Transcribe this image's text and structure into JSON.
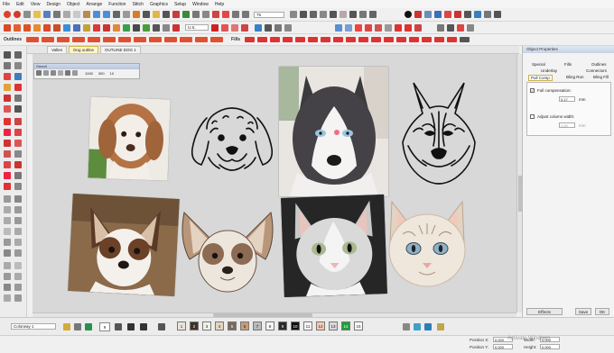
{
  "menu": [
    "File",
    "Edit",
    "View",
    "Design",
    "Object",
    "Arrange",
    "Function",
    "Stitch",
    "Graphics",
    "Setup",
    "Window",
    "Help"
  ],
  "toolbar1": {
    "zoom_value": "75"
  },
  "toolbar2": {
    "units_value": "U.S."
  },
  "toolbar3": {
    "outlines_label": "Outlines",
    "fills_label": "Fills"
  },
  "tabs": [
    {
      "label": "Vallen"
    },
    {
      "label": "Dog outline"
    },
    {
      "label": "OUTLINE DOG 1"
    }
  ],
  "float_window": {
    "title": "Stencil",
    "values": [
      "1000",
      "300",
      "10"
    ]
  },
  "properties": {
    "title": "Object Properties",
    "tabs_row1": [
      "Special",
      "Fills",
      "Outlines"
    ],
    "tabs_row2": [
      "Underlay",
      "Connectors"
    ],
    "tabs_row3": [
      "Pull Comp",
      "Bling Run",
      "Bling Fill"
    ],
    "full_compensation_label": "Full compensation:",
    "full_compensation_value": "0.17",
    "unit": "mm",
    "adjust_width_label": "Adjust column width:",
    "adjust_width_value": "1.00",
    "effects_label": "Effects",
    "save_label": "Save",
    "ok_label": "OK"
  },
  "colorway": {
    "value": "Colorway 1",
    "count": "9"
  },
  "swatches": [
    {
      "label": "1",
      "color": "#e9e3da"
    },
    {
      "label": "2",
      "color": "#3e332b"
    },
    {
      "label": "3",
      "color": "#f0efe8"
    },
    {
      "label": "4",
      "color": "#e3d5c0"
    },
    {
      "label": "5",
      "color": "#7a6a5d"
    },
    {
      "label": "6",
      "color": "#c79b76"
    },
    {
      "label": "7",
      "color": "#b9b9b9"
    },
    {
      "label": "8",
      "color": "#f4f4f4"
    },
    {
      "label": "9",
      "color": "#2b2b2b"
    },
    {
      "label": "10",
      "color": "#111111"
    },
    {
      "label": "11",
      "color": "#f6f6f6"
    },
    {
      "label": "12",
      "color": "#f4c9b0"
    },
    {
      "label": "13",
      "color": "#d8d8d8"
    },
    {
      "label": "14",
      "color": "#1fa03a"
    },
    {
      "label": "15",
      "color": "#fbfbfb"
    }
  ],
  "status": {
    "position_x_label": "Position X:",
    "position_x_value": "0.000",
    "position_y_label": "Position Y:",
    "position_y_value": "0.000",
    "width_label": "Width:",
    "width_value": "0.000",
    "height_label": "Height:",
    "height_value": "0.000",
    "watermark": "Activate Windows"
  }
}
